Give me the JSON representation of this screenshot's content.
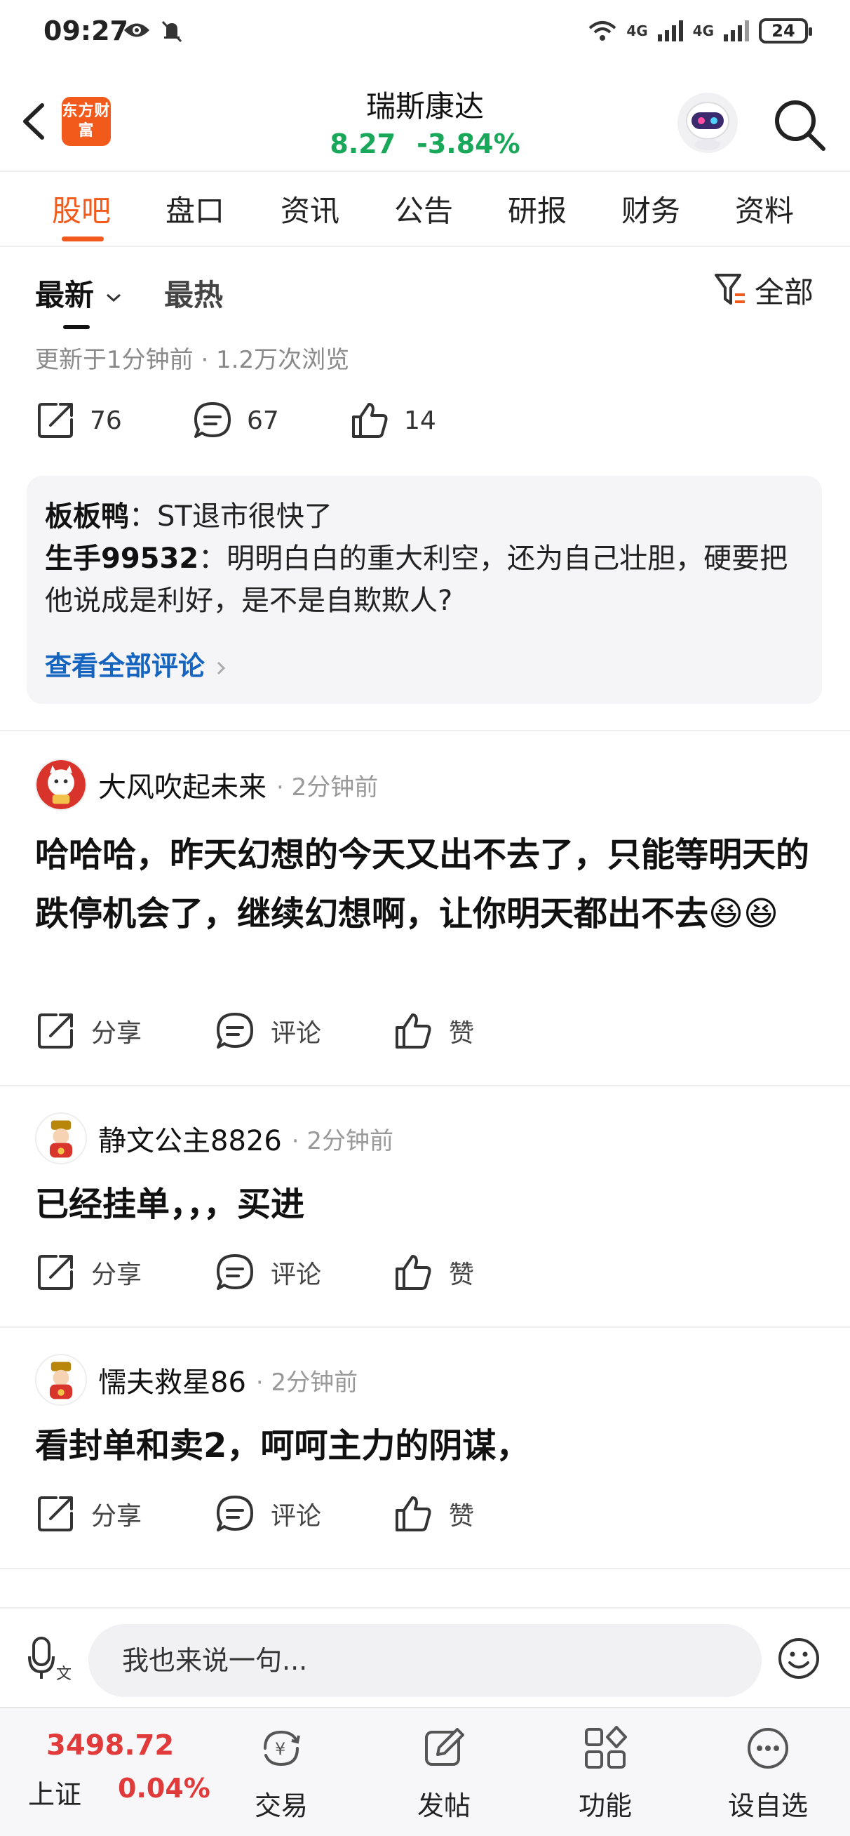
{
  "status_bar": {
    "time": "09:27",
    "network_1": "4G",
    "network_2": "4G",
    "battery": "24"
  },
  "header": {
    "logo_text": "东方财富",
    "stock_name": "瑞斯康达",
    "price": "8.27",
    "change_pct": "-3.84%"
  },
  "tabs": [
    "股吧",
    "盘口",
    "资讯",
    "公告",
    "研报",
    "财务",
    "资料"
  ],
  "sort": {
    "latest": "最新",
    "hottest": "最热",
    "filter": "全部"
  },
  "update_info": "更新于1分钟前 · 1.2万次浏览",
  "stats": {
    "shares": "76",
    "comments": "67",
    "likes": "14"
  },
  "hot_comments": [
    {
      "user": "板板鸭",
      "text": "：ST退市很快了"
    },
    {
      "user": "生手99532",
      "text": "：明明白白的重大利空，还为自己壮胆，硬要把他说成是利好，是不是自欺欺人?"
    }
  ],
  "view_all_comments": "查看全部评论",
  "posts": [
    {
      "user": "大风吹起未来",
      "time": "· 2分钟前",
      "content": "哈哈哈，昨天幻想的今天又出不去了，只能等明天的跌停机会了，继续幻想啊，让你明天都出不去😆😆"
    },
    {
      "user": "静文公主8826",
      "time": "· 2分钟前",
      "content": "已经挂单，，，买进"
    },
    {
      "user": "懦夫救星86",
      "time": "· 2分钟前",
      "content": "看封单和卖2，呵呵主力的阴谋，"
    }
  ],
  "post_actions": {
    "share": "分享",
    "comment": "评论",
    "like": "赞"
  },
  "comment_bar": {
    "placeholder": "我也来说一句..."
  },
  "bottom_nav": {
    "index_value": "3498.72",
    "index_name": "上证",
    "index_pct": "0.04%",
    "items": [
      "交易",
      "发帖",
      "功能",
      "设自选"
    ]
  },
  "colors": {
    "brand": "#f25a1c",
    "down": "#19a75a",
    "up": "#e03a3a",
    "link": "#1565c0"
  }
}
